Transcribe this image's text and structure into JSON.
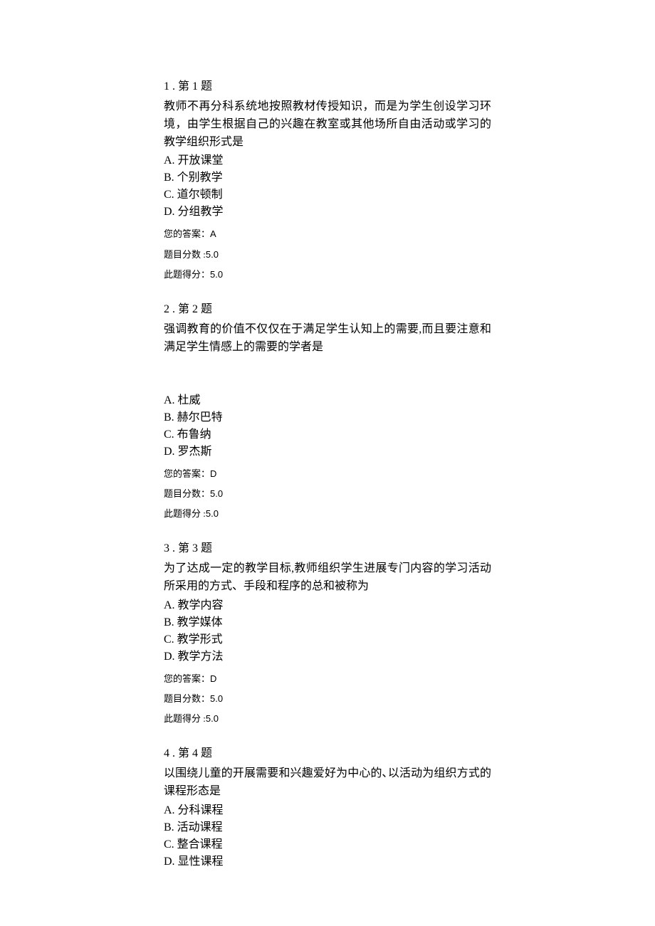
{
  "questions": [
    {
      "index_label": "1 . 第 1 题",
      "body": "教师不再分科系统地按照教材传授知识，而是为学生创设学习环境，由学生根据自己的兴趣在教室或其他场所自由活动或学习的教学组织形式是",
      "options": {
        "A": "A. 开放课堂",
        "B": "B. 个别教学",
        "C": "C. 道尔顿制",
        "D": "D. 分组教学"
      },
      "answer_label": "您的答案：",
      "answer_value": "A",
      "score_label": "题目分数 :",
      "score_value": "5.0",
      "earned_label": "此题得分：",
      "earned_value": "5.0",
      "has_gap": false
    },
    {
      "index_label": "2 . 第 2 题",
      "body": "强调教育的价值不仅仅在于满足学生认知上的需要,而且要注意和满足学生情感上的需要的学者是",
      "options": {
        "A": "A. 杜威",
        "B": "B. 赫尔巴特",
        "C": "C. 布鲁纳",
        "D": "D. 罗杰斯"
      },
      "answer_label": "您的答案：",
      "answer_value": "D",
      "score_label": "题目分数：",
      "score_value": "5.0",
      "earned_label": "此题得分 :",
      "earned_value": "5.0",
      "has_gap": true
    },
    {
      "index_label": "3 . 第 3 题",
      "body": "为了达成一定的教学目标,教师组织学生进展专门内容的学习活动所采用的方式、手段和程序的总和被称为",
      "options": {
        "A": "A. 教学内容",
        "B": "B. 教学媒体",
        "C": "C. 教学形式",
        "D": "D. 教学方法"
      },
      "answer_label": "您的答案：",
      "answer_value": "D",
      "score_label": "题目分数：",
      "score_value": "5.0",
      "earned_label": "此题得分 :",
      "earned_value": "5.0",
      "has_gap": false
    },
    {
      "index_label": "4 . 第 4 题",
      "body": "以围绕儿童的开展需要和兴趣爱好为中心的､以活动为组织方式的课程形态是",
      "options": {
        "A": "A. 分科课程",
        "B": "B. 活动课程",
        "C": "C. 整合课程",
        "D": "D. 显性课程"
      },
      "answer_label": "",
      "answer_value": "",
      "score_label": "",
      "score_value": "",
      "earned_label": "",
      "earned_value": "",
      "has_gap": false
    }
  ]
}
